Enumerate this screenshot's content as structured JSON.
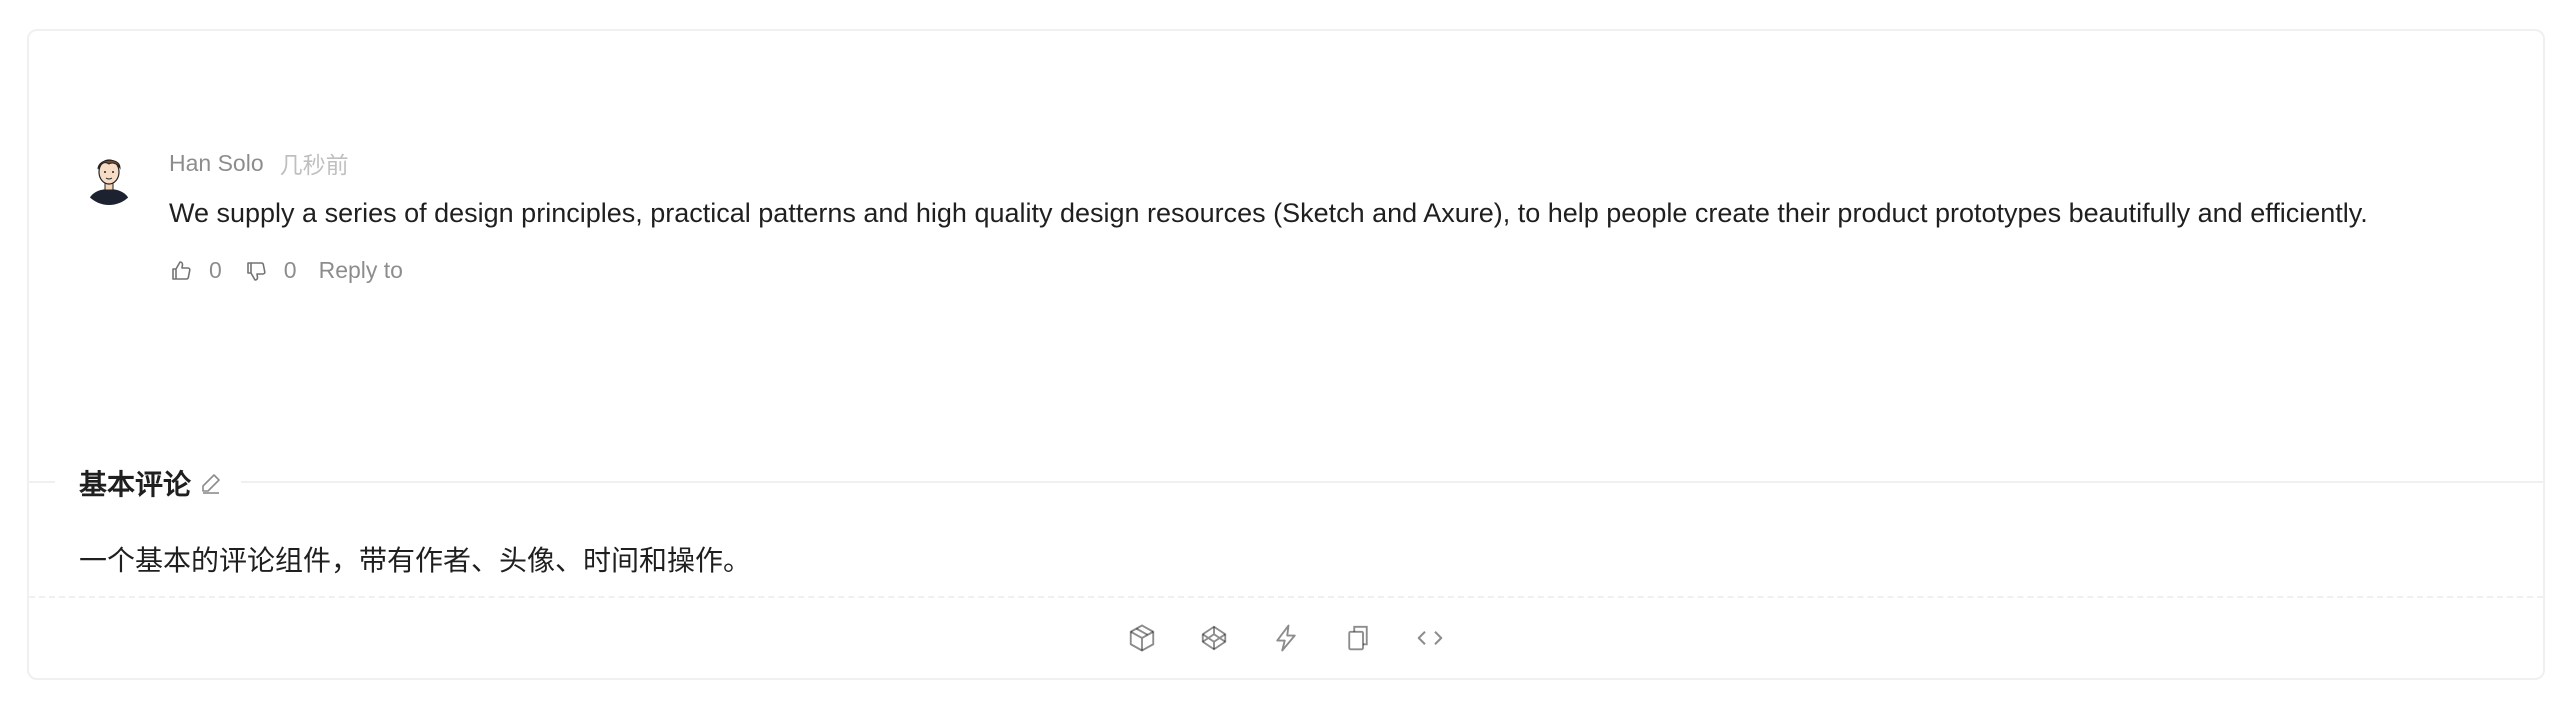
{
  "comment": {
    "author": "Han Solo",
    "time": "几秒前",
    "content": "We supply a series of design principles, practical patterns and high quality design resources (Sketch and Axure), to help people create their product prototypes beautifully and efficiently.",
    "likes": "0",
    "dislikes": "0",
    "reply_label": "Reply to"
  },
  "meta": {
    "title": "基本评论",
    "description": "一个基本的评论组件，带有作者、头像、时间和操作。"
  },
  "icons": {
    "avatar": "avatar-illustration",
    "like": "like-icon",
    "dislike": "dislike-icon",
    "edit": "edit-icon",
    "codesandbox": "codesandbox-icon",
    "codepen": "codepen-icon",
    "stackblitz": "stackblitz-icon",
    "copy": "copy-icon",
    "code": "code-icon"
  },
  "colors": {
    "text": "#1f1f1f",
    "muted": "#8c8c8c",
    "border": "#f0f0f0"
  }
}
